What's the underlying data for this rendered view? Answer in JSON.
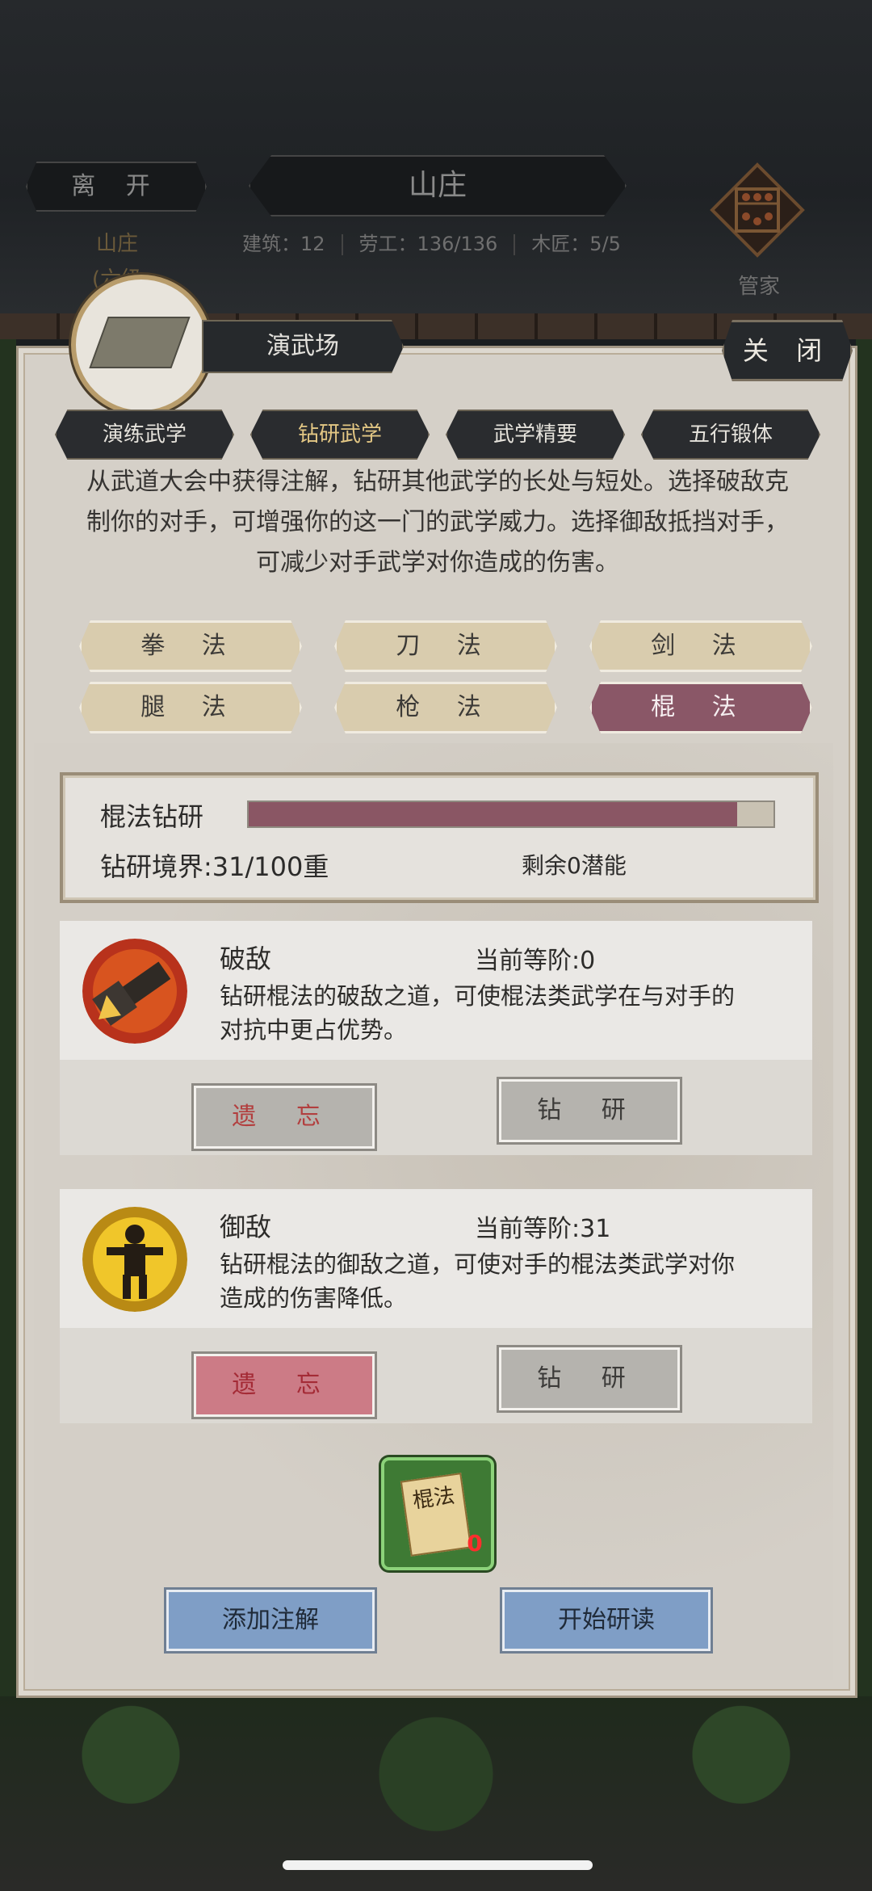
{
  "hud": {
    "leave": "离 开",
    "title": "山庄",
    "stats": {
      "buildings": "建筑：12",
      "laborers": "劳工：136/136",
      "carpenters": "木匠：5/5"
    },
    "side_label_1": "山庄",
    "side_label_2": "(六级",
    "steward": "管家"
  },
  "panel": {
    "venue": "演武场",
    "close": "关 闭",
    "tabs": [
      "演练武学",
      "钻研武学",
      "武学精要",
      "五行锻体"
    ],
    "active_tab": 1,
    "description": "从武道大会中获得注解，钻研其他武学的长处与短处。选择破敌克制你的对手，可增强你的这一门的武学威力。选择御敌抵挡对手，可减少对手武学对你造成的伤害。",
    "categories": [
      "拳 法",
      "刀 法",
      "剑 法",
      "腿 法",
      "枪 法",
      "棍 法"
    ],
    "selected_category": 5,
    "progress": {
      "label": "棍法钻研",
      "fill_fraction": 0.93,
      "realm": "钻研境界:31/100重",
      "remaining": "剩余0潜能"
    },
    "skills": [
      {
        "name": "破敌",
        "level": "当前等阶:0",
        "desc": "钻研棍法的破敌之道，可使棍法类武学在与对手的对抗中更占优势。",
        "forget": "遗 忘",
        "study": "钻 研"
      },
      {
        "name": "御敌",
        "level": "当前等阶:31",
        "desc": "钻研棍法的御敌之道，可使对手的棍法类武学对你造成的伤害降低。",
        "forget": "遗 忘",
        "study": "钻 研"
      }
    ],
    "note_item": {
      "title": "棍法",
      "count": "0"
    },
    "add_note": "添加注解",
    "start_reading": "开始研读"
  },
  "colors": {
    "selected_category": "#8a5767",
    "progress_fill": "#8a5664",
    "forget_active": "#cc7b86",
    "action_blue": "#7f9ec6"
  }
}
